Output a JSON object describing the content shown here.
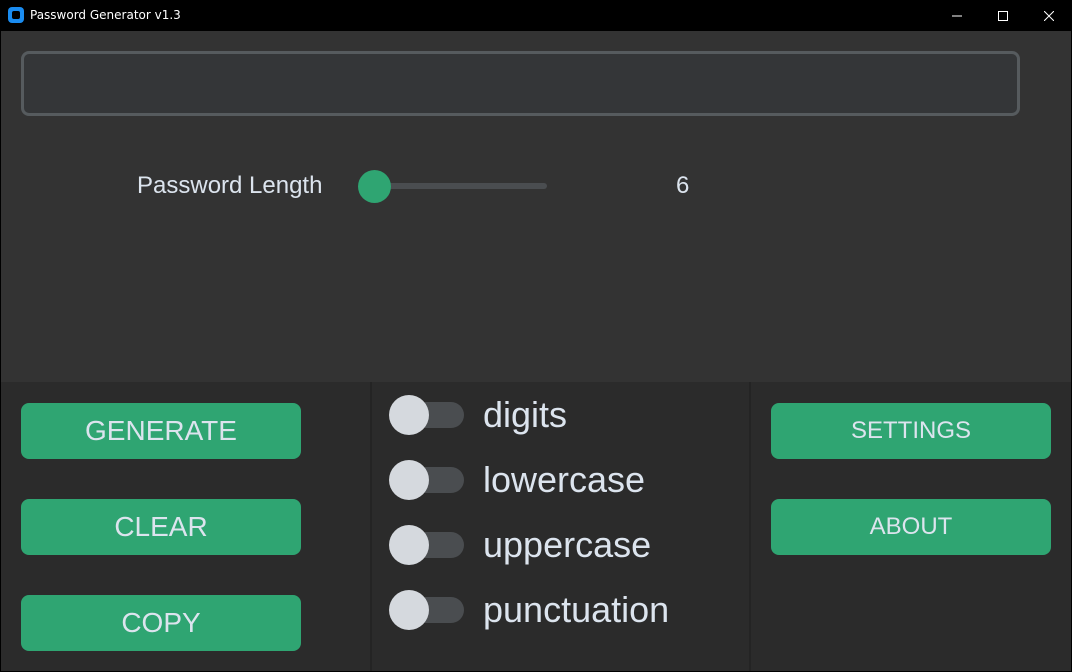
{
  "window": {
    "title": "Password Generator v1.3",
    "controls": {
      "minimize": "—",
      "maximize": "☐",
      "close": "✕"
    }
  },
  "password": {
    "value": "",
    "placeholder": ""
  },
  "length": {
    "label": "Password Length",
    "value": "6",
    "slider_fraction": 0.0
  },
  "buttons": {
    "generate": "GENERATE",
    "clear": "CLEAR",
    "copy": "COPY",
    "settings": "SETTINGS",
    "about": "ABOUT"
  },
  "options": [
    {
      "label": "digits",
      "on": false
    },
    {
      "label": "lowercase",
      "on": false
    },
    {
      "label": "uppercase",
      "on": false
    },
    {
      "label": "punctuation",
      "on": false
    }
  ],
  "colors": {
    "accent": "#2fa572",
    "panel": "#333333",
    "frame": "#2b2b2b",
    "text": "#dce4ee",
    "switch_off": "#4a4d50",
    "switch_knob": "#d5d9de"
  },
  "icons": {
    "app": "app-icon",
    "minimize": "minimize-icon",
    "maximize": "maximize-icon",
    "close": "close-icon"
  }
}
